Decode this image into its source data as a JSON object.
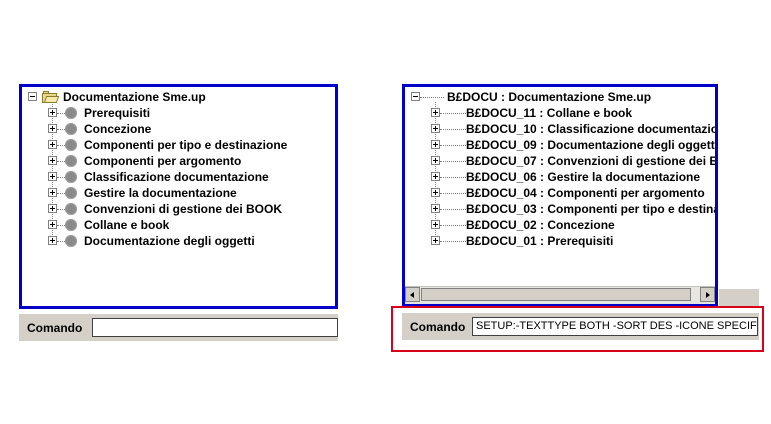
{
  "left_tree": {
    "root": "Documentazione Sme.up",
    "items": [
      "Prerequisiti",
      "Concezione",
      "Componenti per tipo e destinazione",
      "Componenti per argomento",
      "Classificazione documentazione",
      "Gestire la documentazione",
      "Convenzioni di gestione dei BOOK",
      "Collane e book",
      "Documentazione degli oggetti"
    ]
  },
  "right_tree": {
    "root": "B£DOCU : Documentazione Sme.up",
    "items": [
      "B£DOCU_11 : Collane e book",
      "B£DOCU_10 : Classificazione documentazio",
      "B£DOCU_09 : Documentazione degli oggett",
      "B£DOCU_07 : Convenzioni di gestione dei E",
      "B£DOCU_06 : Gestire la documentazione",
      "B£DOCU_04 : Componenti per argomento",
      "B£DOCU_03 : Componenti per tipo e destina",
      "B£DOCU_02 : Concezione",
      "B£DOCU_01 : Prerequisiti"
    ]
  },
  "left_command": {
    "label": "Comando",
    "value": ""
  },
  "right_command": {
    "label": "Comando",
    "value": "SETUP:-TEXTTYPE BOTH -SORT DES -ICONE SPECIFIC"
  },
  "colors": {
    "frame_border": "#0000c8",
    "highlight": "#d9001a",
    "panel": "#d4d0c8"
  }
}
